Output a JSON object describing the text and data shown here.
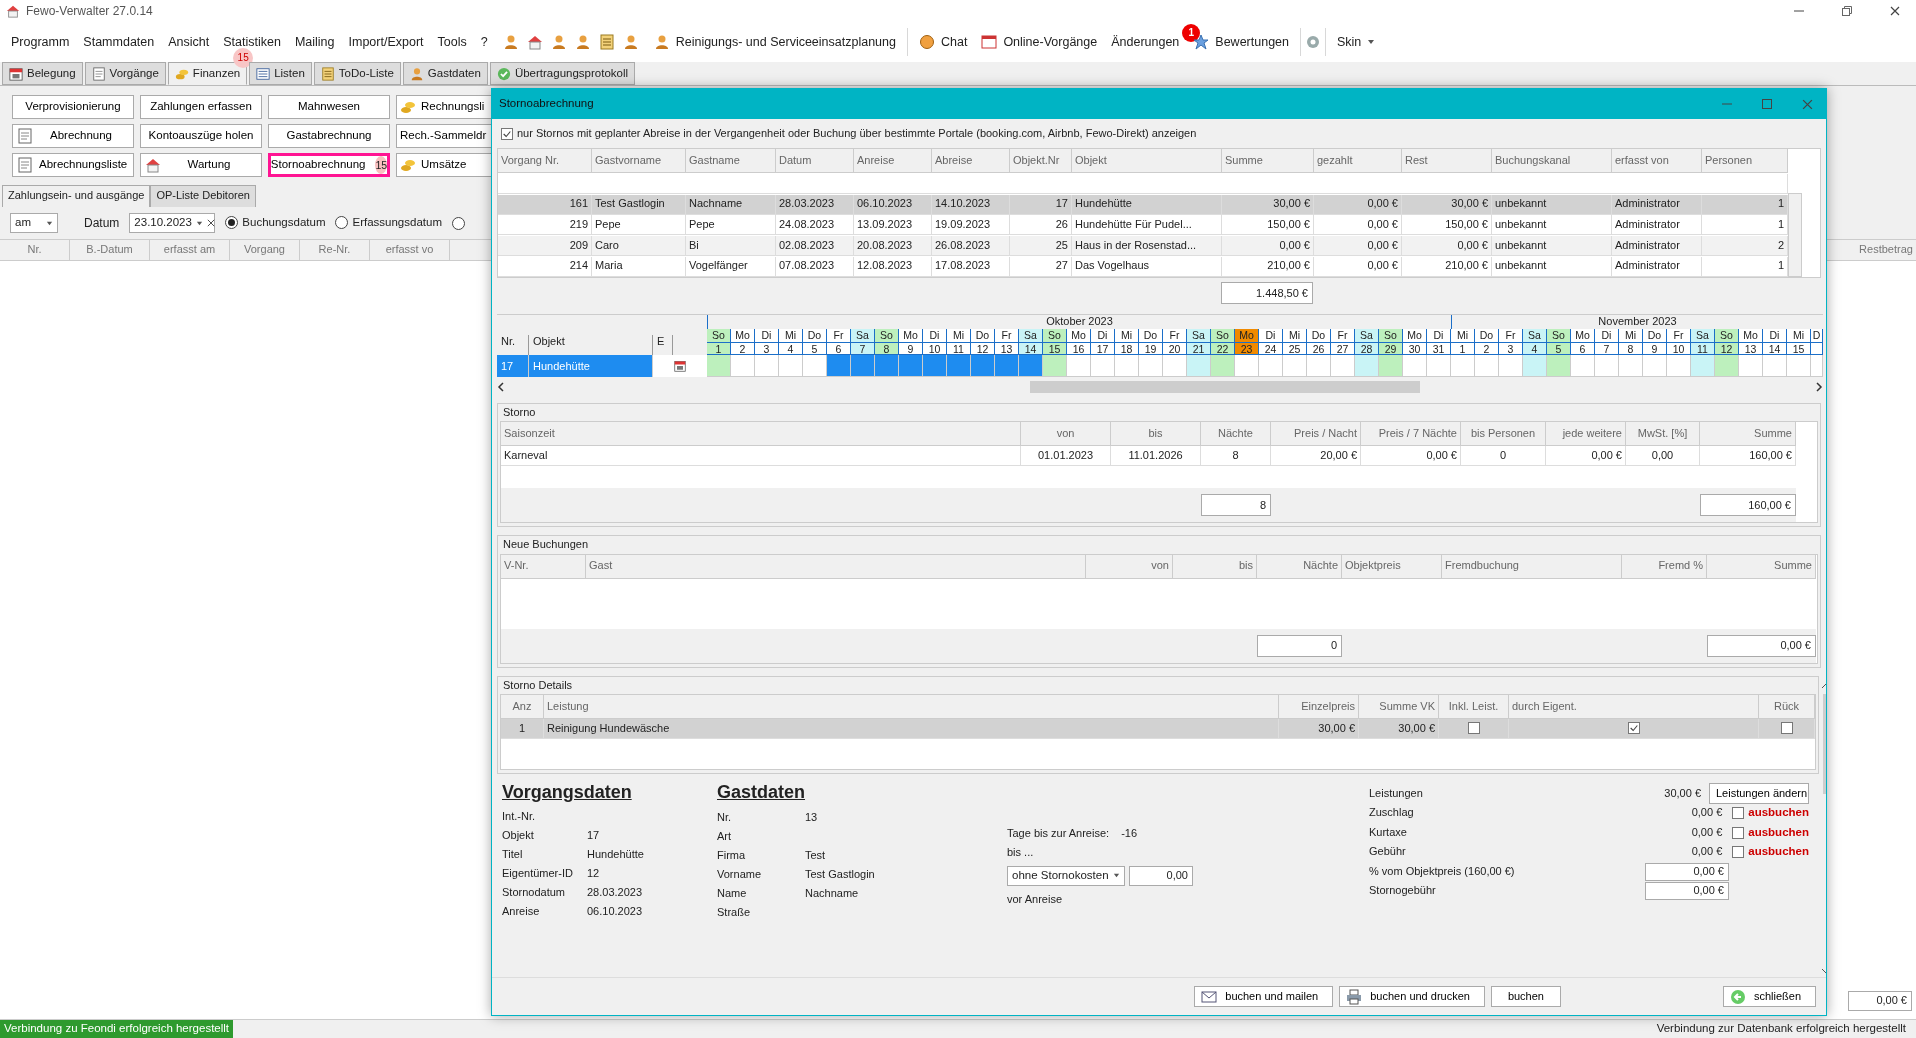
{
  "app": {
    "title": "Fewo-Verwalter 27.0.14"
  },
  "menu": [
    {
      "label": "Programm"
    },
    {
      "label": "Stammdaten"
    },
    {
      "label": "Ansicht"
    },
    {
      "label": "Statistiken"
    },
    {
      "label": "Mailing"
    },
    {
      "label": "Import/Export"
    },
    {
      "label": "Tools"
    },
    {
      "label": "?"
    }
  ],
  "toolbar": [
    {
      "label": "Reinigungs- und Serviceeinsatzplanung"
    },
    {
      "label": "Chat"
    },
    {
      "label": "Online-Vorgänge"
    },
    {
      "label": "Änderungen",
      "badge": "1"
    },
    {
      "label": "Bewertungen"
    },
    {
      "label": "Skin"
    }
  ],
  "main_tabs": [
    {
      "label": "Belegung",
      "selected": false
    },
    {
      "label": "Vorgänge",
      "selected": false
    },
    {
      "label": "Finanzen",
      "selected": true,
      "badge": "15"
    },
    {
      "label": "Listen",
      "selected": false
    },
    {
      "label": "ToDo-Liste",
      "selected": false
    },
    {
      "label": "Gastdaten",
      "selected": false
    },
    {
      "label": "Übertragungsprotokoll",
      "selected": false
    }
  ],
  "buttons": [
    [
      {
        "label": "Verprovisionierung",
        "highlighted": false
      },
      {
        "label": "Zahlungen erfassen",
        "highlighted": false
      },
      {
        "label": "Mahnwesen",
        "highlighted": false
      },
      {
        "label": "Rechnungsli",
        "highlighted": false
      }
    ],
    [
      {
        "label": "Abrechnung",
        "highlighted": false
      },
      {
        "label": "Kontoauszüge holen",
        "highlighted": false
      },
      {
        "label": "Gastabrechnung",
        "highlighted": false
      },
      {
        "label": "Rech.-Sammeldr",
        "highlighted": false
      }
    ],
    [
      {
        "label": "Abrechnungsliste",
        "highlighted": false
      },
      {
        "label": "Wartung",
        "highlighted": false
      },
      {
        "label": "Stornoabrechnung",
        "highlighted": true,
        "badge": "15"
      },
      {
        "label": "Umsätze",
        "highlighted": false
      }
    ]
  ],
  "sub_tabs": [
    {
      "label": "Zahlungsein- und ausgänge",
      "selected": true
    },
    {
      "label": "OP-Liste Debitoren",
      "selected": false
    }
  ],
  "filter": {
    "mode": "am",
    "date_label": "Datum",
    "date": "23.10.2023",
    "options": [
      {
        "label": "Buchungsdatum",
        "selected": true
      },
      {
        "label": "Erfassungsdatum",
        "selected": false
      },
      {
        "selected": false
      }
    ]
  },
  "payments": {
    "columns": [
      "Nr.",
      "B.-Datum",
      "erfasst am",
      "Vorgang",
      "Re-Nr.",
      "erfasst vo"
    ],
    "last_column": "Restbetrag",
    "total": "0,00 €"
  },
  "status_bar": {
    "left": "Verbindung zu Feondi erfolgreich hergestellt",
    "right": "Verbindung zur Datenbank erfolgreich hergestellt"
  },
  "dialog": {
    "title": "Stornoabrechnung",
    "filter_checkbox": {
      "label": "nur Stornos mit geplanter Abreise in der Vergangenheit oder Buchung über bestimmte Portale (booking.com, Airbnb, Fewo-Direkt) anzeigen",
      "checked": true
    },
    "bookings": {
      "columns": [
        "Vorgang Nr.",
        "Gastvorname",
        "Gastname",
        "Datum",
        "Anreise",
        "Abreise",
        "Objekt.Nr",
        "Objekt",
        "Summe",
        "gezahlt",
        "Rest",
        "Buchungskanal",
        "erfasst von",
        "Personen"
      ],
      "rows": [
        {
          "selected": true,
          "cells": [
            "161",
            "Test Gastlogin",
            "Nachname",
            "28.03.2023",
            "06.10.2023",
            "14.10.2023",
            "17",
            "Hundehütte",
            "30,00 €",
            "0,00 €",
            "30,00 €",
            "unbekannt",
            "Administrator",
            "1"
          ]
        },
        {
          "selected": false,
          "cells": [
            "219",
            "Pepe",
            "Pepe",
            "24.08.2023",
            "13.09.2023",
            "19.09.2023",
            "26",
            "Hundehütte Für Pudel...",
            "150,00 €",
            "0,00 €",
            "150,00 €",
            "unbekannt",
            "Administrator",
            "1"
          ]
        },
        {
          "selected": false,
          "cells": [
            "209",
            "Caro",
            "Bi",
            "02.08.2023",
            "20.08.2023",
            "26.08.2023",
            "25",
            "Haus in der Rosenstad...",
            "0,00 €",
            "0,00 €",
            "0,00 €",
            "unbekannt",
            "Administrator",
            "2"
          ]
        },
        {
          "selected": false,
          "cells": [
            "214",
            "Maria",
            "Vogelfänger",
            "07.08.2023",
            "12.08.2023",
            "17.08.2023",
            "27",
            "Das Vogelhaus",
            "210,00 €",
            "0,00 €",
            "210,00 €",
            "unbekannt",
            "Administrator",
            "1"
          ]
        }
      ],
      "total": "1.448,50 €"
    },
    "calendar": {
      "columns": [
        "Nr.",
        "Objekt",
        "E"
      ],
      "months": [
        {
          "label": "Oktober 2023",
          "days": [
            {
              "dow": "So",
              "day": "1",
              "kind": "sunday",
              "booked": false
            },
            {
              "dow": "Mo",
              "day": "2",
              "kind": "weekday",
              "booked": false
            },
            {
              "dow": "Di",
              "day": "3",
              "kind": "weekday",
              "booked": false
            },
            {
              "dow": "Mi",
              "day": "4",
              "kind": "weekday",
              "booked": false
            },
            {
              "dow": "Do",
              "day": "5",
              "kind": "weekday",
              "booked": false
            },
            {
              "dow": "Fr",
              "day": "6",
              "kind": "weekday",
              "booked": true
            },
            {
              "dow": "Sa",
              "day": "7",
              "kind": "saturday",
              "booked": true
            },
            {
              "dow": "So",
              "day": "8",
              "kind": "sunday",
              "booked": true
            },
            {
              "dow": "Mo",
              "day": "9",
              "kind": "weekday",
              "booked": true
            },
            {
              "dow": "Di",
              "day": "10",
              "kind": "weekday",
              "booked": true
            },
            {
              "dow": "Mi",
              "day": "11",
              "kind": "weekday",
              "booked": true
            },
            {
              "dow": "Do",
              "day": "12",
              "kind": "weekday",
              "booked": true
            },
            {
              "dow": "Fr",
              "day": "13",
              "kind": "weekday",
              "booked": true
            },
            {
              "dow": "Sa",
              "day": "14",
              "kind": "saturday",
              "booked": true
            },
            {
              "dow": "So",
              "day": "15",
              "kind": "sunday",
              "booked": false
            },
            {
              "dow": "Mo",
              "day": "16",
              "kind": "weekday",
              "booked": false
            },
            {
              "dow": "Di",
              "day": "17",
              "kind": "weekday",
              "booked": false
            },
            {
              "dow": "Mi",
              "day": "18",
              "kind": "weekday",
              "booked": false
            },
            {
              "dow": "Do",
              "day": "19",
              "kind": "weekday",
              "booked": false
            },
            {
              "dow": "Fr",
              "day": "20",
              "kind": "weekday",
              "booked": false
            },
            {
              "dow": "Sa",
              "day": "21",
              "kind": "saturday",
              "booked": false
            },
            {
              "dow": "So",
              "day": "22",
              "kind": "sunday",
              "booked": false
            },
            {
              "dow": "Mo",
              "day": "23",
              "kind": "today",
              "booked": false
            },
            {
              "dow": "Di",
              "day": "24",
              "kind": "weekday",
              "booked": false
            },
            {
              "dow": "Mi",
              "day": "25",
              "kind": "weekday",
              "booked": false
            },
            {
              "dow": "Do",
              "day": "26",
              "kind": "weekday",
              "booked": false
            },
            {
              "dow": "Fr",
              "day": "27",
              "kind": "weekday",
              "booked": false
            },
            {
              "dow": "Sa",
              "day": "28",
              "kind": "saturday",
              "booked": false
            },
            {
              "dow": "So",
              "day": "29",
              "kind": "sunday",
              "booked": false
            },
            {
              "dow": "Mo",
              "day": "30",
              "kind": "weekday",
              "booked": false
            },
            {
              "dow": "Di",
              "day": "31",
              "kind": "weekday",
              "booked": false
            }
          ]
        },
        {
          "label": "November 2023",
          "days": [
            {
              "dow": "Mi",
              "day": "1",
              "kind": "weekday",
              "booked": false
            },
            {
              "dow": "Do",
              "day": "2",
              "kind": "weekday",
              "booked": false
            },
            {
              "dow": "Fr",
              "day": "3",
              "kind": "weekday",
              "booked": false
            },
            {
              "dow": "Sa",
              "day": "4",
              "kind": "saturday",
              "booked": false
            },
            {
              "dow": "So",
              "day": "5",
              "kind": "sunday",
              "booked": false
            },
            {
              "dow": "Mo",
              "day": "6",
              "kind": "weekday",
              "booked": false
            },
            {
              "dow": "Di",
              "day": "7",
              "kind": "weekday",
              "booked": false
            },
            {
              "dow": "Mi",
              "day": "8",
              "kind": "weekday",
              "booked": false
            },
            {
              "dow": "Do",
              "day": "9",
              "kind": "weekday",
              "booked": false
            },
            {
              "dow": "Fr",
              "day": "10",
              "kind": "weekday",
              "booked": false
            },
            {
              "dow": "Sa",
              "day": "11",
              "kind": "saturday",
              "booked": false
            },
            {
              "dow": "So",
              "day": "12",
              "kind": "sunday",
              "booked": false
            },
            {
              "dow": "Mo",
              "day": "13",
              "kind": "weekday",
              "booked": false
            },
            {
              "dow": "Di",
              "day": "14",
              "kind": "weekday",
              "booked": false
            },
            {
              "dow": "Mi",
              "day": "15",
              "kind": "weekday",
              "booked": false
            },
            {
              "dow": "D",
              "kind": "weekday",
              "booked": false
            }
          ]
        }
      ],
      "rows": [
        {
          "nr": "17",
          "objekt": "Hundehütte",
          "selected": true
        }
      ]
    },
    "storno": {
      "title": "Storno",
      "columns": [
        "Saisonzeit",
        "von",
        "bis",
        "Nächte",
        "Preis / Nacht",
        "Preis / 7 Nächte",
        "bis Personen",
        "jede weitere",
        "MwSt. [%]",
        "Summe"
      ],
      "rows": [
        [
          "Karneval",
          "01.01.2023",
          "11.01.2026",
          "8",
          "20,00 €",
          "0,00 €",
          "0",
          "0,00 €",
          "0,00",
          "160,00 €"
        ]
      ],
      "total_nights": "8",
      "total_sum": "160,00 €"
    },
    "new_bookings": {
      "title": "Neue Buchungen",
      "columns": [
        "V-Nr.",
        "Gast",
        "von",
        "bis",
        "Nächte",
        "Objektpreis",
        "Fremdbuchung",
        "Fremd %",
        "Summe"
      ],
      "total_nights": "0",
      "total_sum": "0,00 €"
    },
    "storno_details": {
      "title": "Storno Details",
      "columns": [
        "Anz",
        "Leistung",
        "Einzelpreis",
        "Summe VK",
        "Inkl. Leist.",
        "durch Eigent.",
        "Rück"
      ],
      "rows": [
        {
          "selected": true,
          "anz": "1",
          "leistung": "Reinigung Hundewäsche",
          "einzelpreis": "30,00 €",
          "summe": "30,00 €",
          "inkl": false,
          "eigent": true,
          "rueck": false
        }
      ]
    },
    "vorgangsdaten": {
      "title": "Vorgangsdaten",
      "fields": [
        {
          "label": "Int.-Nr."
        },
        {
          "label": "Objekt",
          "value": "17"
        },
        {
          "label": "Titel",
          "value": "Hundehütte"
        },
        {
          "label": "Eigentümer-ID",
          "value": "12"
        },
        {
          "label": "Stornodatum",
          "value": "28.03.2023"
        },
        {
          "label": "Anreise",
          "value": "06.10.2023"
        }
      ]
    },
    "gastdaten": {
      "title": "Gastdaten",
      "fields": [
        {
          "label": "Nr.",
          "value": "13"
        },
        {
          "label": "Art"
        },
        {
          "label": "Firma",
          "value": "Test"
        },
        {
          "label": "Vorname",
          "value": "Test Gastlogin"
        },
        {
          "label": "Name",
          "value": "Nachname"
        },
        {
          "label": "Straße"
        }
      ]
    },
    "stornofrist": {
      "days_label": "Tage bis zur Anreise:",
      "days": "-16",
      "bis": "bis ...",
      "select": "ohne Stornokosten",
      "amount": "0,00",
      "vor": "vor Anreise"
    },
    "charges": [
      {
        "kind": "button",
        "label": "Leistungen",
        "amount": "30,00 €",
        "button": "Leistungen ändern"
      },
      {
        "kind": "checkbox",
        "label": "Zuschlag",
        "amount": "0,00 €",
        "checked": false,
        "action": "ausbuchen"
      },
      {
        "kind": "checkbox",
        "label": "Kurtaxe",
        "amount": "0,00 €",
        "checked": false,
        "action": "ausbuchen"
      },
      {
        "kind": "checkbox",
        "label": "Gebühr",
        "amount": "0,00 €",
        "checked": false,
        "action": "ausbuchen"
      },
      {
        "kind": "field",
        "label": "% vom Objektpreis (160,00 €)",
        "value": "0,00 €"
      },
      {
        "kind": "field",
        "label": "Stornogebühr",
        "value": "0,00 €"
      }
    ],
    "actions": [
      {
        "label": "buchen und mailen"
      },
      {
        "label": "buchen und drucken"
      },
      {
        "label": "buchen"
      },
      {
        "label": "schließen"
      }
    ]
  }
}
